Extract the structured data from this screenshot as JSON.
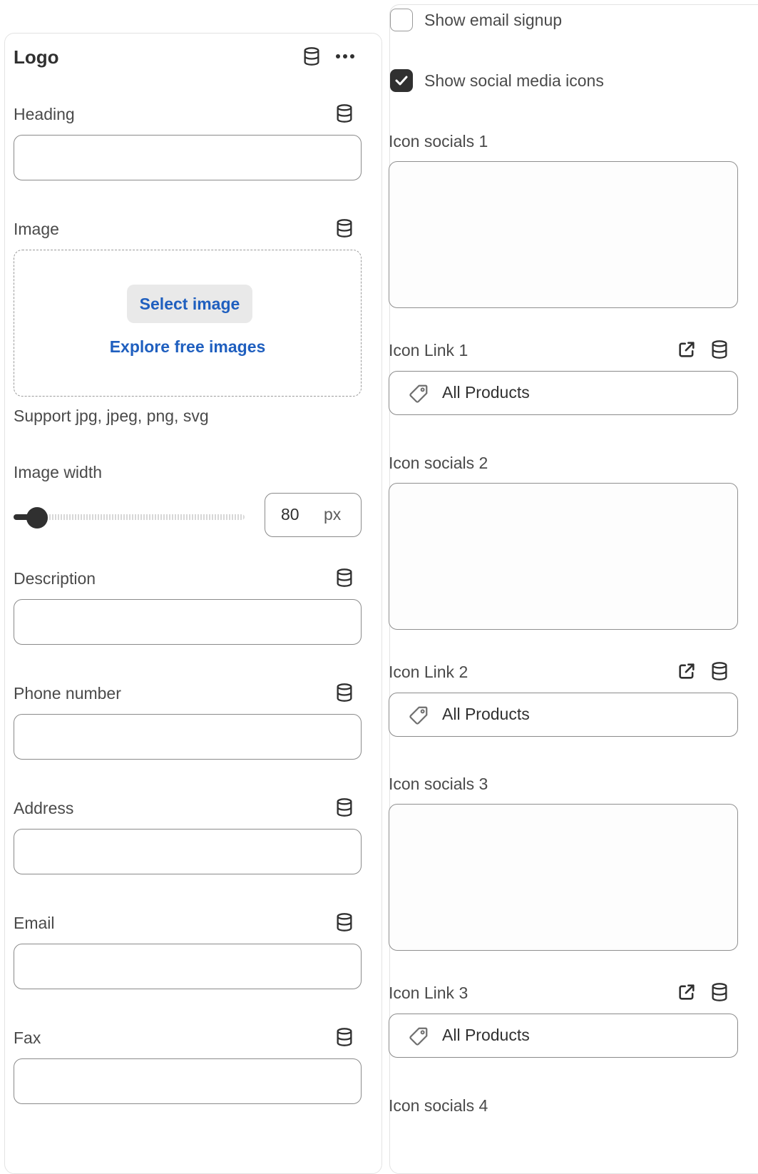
{
  "left": {
    "title": "Logo",
    "heading_label": "Heading",
    "image_label": "Image",
    "select_image": "Select image",
    "explore_images": "Explore free images",
    "image_help": "Support jpg, jpeg, png, svg",
    "image_width_label": "Image width",
    "image_width_value": "80",
    "image_width_unit": "px",
    "description_label": "Description",
    "phone_label": "Phone number",
    "address_label": "Address",
    "email_label": "Email",
    "fax_label": "Fax"
  },
  "right": {
    "show_email_signup": "Show email signup",
    "show_social_icons": "Show social media icons",
    "icon_socials_1": "Icon socials 1",
    "icon_link_1": "Icon Link 1",
    "link_1_value": "All Products",
    "icon_socials_2": "Icon socials 2",
    "icon_link_2": "Icon Link 2",
    "link_2_value": "All Products",
    "icon_socials_3": "Icon socials 3",
    "icon_link_3": "Icon Link 3",
    "link_3_value": "All Products",
    "icon_socials_4": "Icon socials 4"
  },
  "state": {
    "show_email_signup_checked": false,
    "show_social_icons_checked": true,
    "image_width_slider_fraction": 0.1
  },
  "icons": {
    "dynamic_source": "database-icon",
    "more": "ellipsis-icon",
    "open_link": "external-link-icon",
    "resource": "tag-icon",
    "check": "checkmark-icon"
  },
  "colors": {
    "text": "#303030",
    "link": "#1f5fbf",
    "border": "#8a8a8a",
    "checkbox_on": "#303030"
  }
}
